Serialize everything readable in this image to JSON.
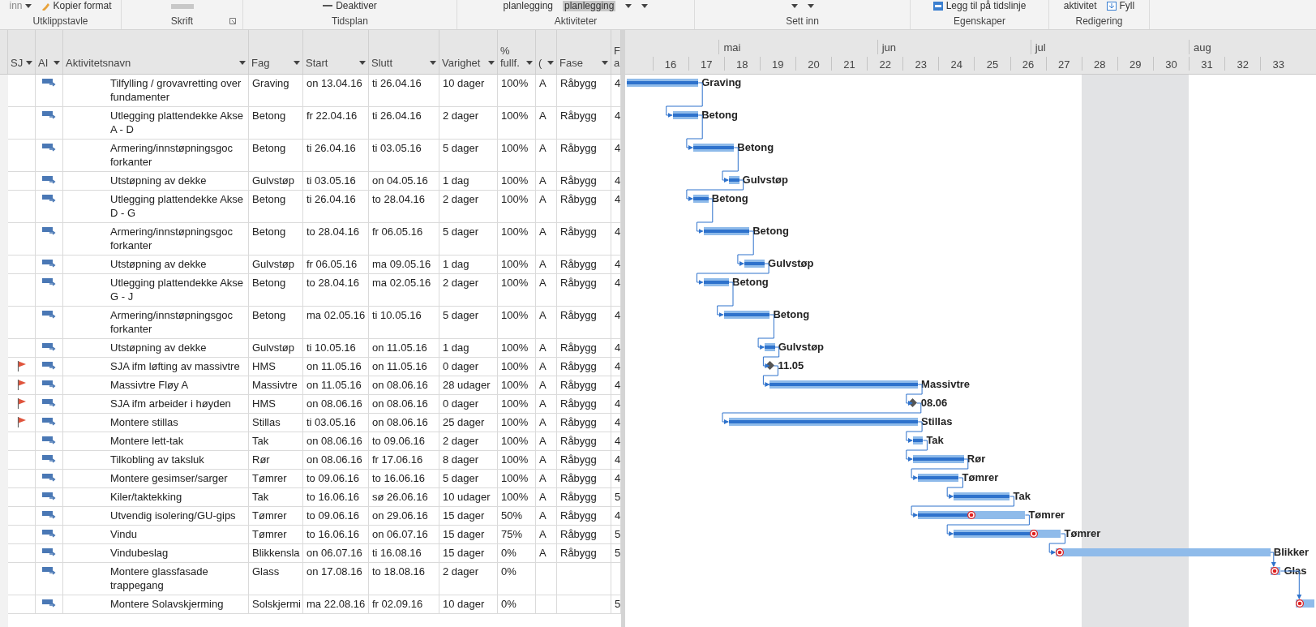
{
  "ribbon": {
    "groups": [
      {
        "label": "Utklippstavle",
        "launcher": false,
        "items": [
          {
            "kind": "menu",
            "text": "inn"
          },
          {
            "kind": "brush",
            "text": "Kopier format"
          }
        ]
      },
      {
        "label": "Skrift",
        "launcher": true,
        "items": [
          {
            "kind": "bar"
          }
        ]
      },
      {
        "label": "Tidsplan",
        "launcher": false,
        "items": [
          {
            "kind": "check",
            "text": "Deaktiver"
          }
        ]
      },
      {
        "label": "Aktiviteter",
        "launcher": false,
        "items": [
          {
            "kind": "plain",
            "text": "planlegging"
          },
          {
            "kind": "highlight",
            "text": "planlegging"
          },
          {
            "kind": "caret"
          },
          {
            "kind": "caret"
          }
        ]
      },
      {
        "label": "Sett inn",
        "launcher": false,
        "items": [
          {
            "kind": "caret"
          },
          {
            "kind": "caret"
          }
        ]
      },
      {
        "label": "Egenskaper",
        "launcher": false,
        "items": [
          {
            "kind": "timeline",
            "text": "Legg til på tidslinje"
          }
        ]
      },
      {
        "label": "Redigering",
        "launcher": false,
        "items": [
          {
            "kind": "plain",
            "text": "aktivitet"
          },
          {
            "kind": "fill",
            "text": "Fyll"
          }
        ]
      }
    ]
  },
  "table": {
    "columns": [
      "SJ",
      "AI",
      "Aktivitetsnavn",
      "Fag",
      "Start",
      "Slutt",
      "Varighet",
      "% fullf.",
      "(",
      "Fase",
      "F a"
    ],
    "rows": [
      {
        "flagged": false,
        "name": "Tilfylling / grovavretting over fundamenter",
        "fag": "Graving",
        "start": "on 13.04.16",
        "slutt": "ti 26.04.16",
        "varighet": "10 dager",
        "fullf": "100%",
        "column_9": "A",
        "fase": "Råbygg",
        "column_11": "4",
        "bar": {
          "kind": "task",
          "label": "Graving",
          "level": 1
        }
      },
      {
        "flagged": false,
        "name": "Utlegging plattendekke Akse A - D",
        "fag": "Betong",
        "start": "fr 22.04.16",
        "slutt": "ti 26.04.16",
        "varighet": "2 dager",
        "fullf": "100%",
        "column_9": "A",
        "fase": "Råbygg",
        "column_11": "4",
        "bar": {
          "kind": "task",
          "label": "Betong",
          "level": 1
        }
      },
      {
        "flagged": false,
        "name": "Armering/innstøpningsgoc forkanter",
        "fag": "Betong",
        "start": "ti 26.04.16",
        "slutt": "ti 03.05.16",
        "varighet": "5 dager",
        "fullf": "100%",
        "column_9": "A",
        "fase": "Råbygg",
        "column_11": "4",
        "bar": {
          "kind": "task",
          "label": "Betong",
          "level": 1
        }
      },
      {
        "flagged": false,
        "name": "Utstøpning av dekke",
        "fag": "Gulvstøp",
        "start": "ti 03.05.16",
        "slutt": "on 04.05.16",
        "varighet": "1 dag",
        "fullf": "100%",
        "column_9": "A",
        "fase": "Råbygg",
        "column_11": "4",
        "bar": {
          "kind": "task",
          "label": "Gulvstøp",
          "level": 1
        }
      },
      {
        "flagged": false,
        "name": "Utlegging plattendekke Akse D - G",
        "fag": "Betong",
        "start": "ti 26.04.16",
        "slutt": "to 28.04.16",
        "varighet": "2 dager",
        "fullf": "100%",
        "column_9": "A",
        "fase": "Råbygg",
        "column_11": "4",
        "bar": {
          "kind": "task",
          "label": "Betong",
          "level": 1
        }
      },
      {
        "flagged": false,
        "name": "Armering/innstøpningsgoc forkanter",
        "fag": "Betong",
        "start": "to 28.04.16",
        "slutt": "fr 06.05.16",
        "varighet": "5 dager",
        "fullf": "100%",
        "column_9": "A",
        "fase": "Råbygg",
        "column_11": "4",
        "bar": {
          "kind": "task",
          "label": "Betong",
          "level": 1
        }
      },
      {
        "flagged": false,
        "name": "Utstøpning av dekke",
        "fag": "Gulvstøp",
        "start": "fr 06.05.16",
        "slutt": "ma 09.05.16",
        "varighet": "1 dag",
        "fullf": "100%",
        "column_9": "A",
        "fase": "Råbygg",
        "column_11": "4",
        "bar": {
          "kind": "task",
          "label": "Gulvstøp",
          "level": 1
        }
      },
      {
        "flagged": false,
        "name": "Utlegging plattendekke Akse G - J",
        "fag": "Betong",
        "start": "to 28.04.16",
        "slutt": "ma 02.05.16",
        "varighet": "2 dager",
        "fullf": "100%",
        "column_9": "A",
        "fase": "Råbygg",
        "column_11": "4",
        "bar": {
          "kind": "task",
          "label": "Betong",
          "level": 1
        }
      },
      {
        "flagged": false,
        "name": "Armering/innstøpningsgoc forkanter",
        "fag": "Betong",
        "start": "ma 02.05.16",
        "slutt": "ti 10.05.16",
        "varighet": "5 dager",
        "fullf": "100%",
        "column_9": "A",
        "fase": "Råbygg",
        "column_11": "4",
        "bar": {
          "kind": "task",
          "label": "Betong",
          "level": 1
        }
      },
      {
        "flagged": false,
        "name": "Utstøpning av dekke",
        "fag": "Gulvstøp",
        "start": "ti 10.05.16",
        "slutt": "on 11.05.16",
        "varighet": "1 dag",
        "fullf": "100%",
        "column_9": "A",
        "fase": "Råbygg",
        "column_11": "4",
        "bar": {
          "kind": "task",
          "label": "Gulvstøp",
          "level": 1
        }
      },
      {
        "flagged": true,
        "name": "SJA ifm løfting av massivtre",
        "fag": "HMS",
        "start": "on 11.05.16",
        "slutt": "on 11.05.16",
        "varighet": "0 dager",
        "fullf": "100%",
        "column_9": "A",
        "fase": "Råbygg",
        "column_11": "4",
        "bar": {
          "kind": "milestone",
          "label": "11.05"
        }
      },
      {
        "flagged": true,
        "name": "Massivtre Fløy A",
        "fag": "Massivtre",
        "start": "on 11.05.16",
        "slutt": "on 08.06.16",
        "varighet": "28 udager",
        "fullf": "100%",
        "column_9": "A",
        "fase": "Råbygg",
        "column_11": "4",
        "bar": {
          "kind": "task",
          "label": "Massivtre",
          "level": 1
        }
      },
      {
        "flagged": true,
        "name": "SJA ifm arbeider i høyden",
        "fag": "HMS",
        "start": "on 08.06.16",
        "slutt": "on 08.06.16",
        "varighet": "0 dager",
        "fullf": "100%",
        "column_9": "A",
        "fase": "Råbygg",
        "column_11": "4",
        "bar": {
          "kind": "milestone",
          "label": "08.06"
        }
      },
      {
        "flagged": true,
        "name": "Montere stillas",
        "fag": "Stillas",
        "start": "ti 03.05.16",
        "slutt": "on 08.06.16",
        "varighet": "25 dager",
        "fullf": "100%",
        "column_9": "A",
        "fase": "Råbygg",
        "column_11": "4",
        "bar": {
          "kind": "task",
          "label": "Stillas",
          "level": 1
        }
      },
      {
        "flagged": false,
        "name": "Montere lett-tak",
        "fag": "Tak",
        "start": "on 08.06.16",
        "slutt": "to 09.06.16",
        "varighet": "2 dager",
        "fullf": "100%",
        "column_9": "A",
        "fase": "Råbygg",
        "column_11": "4",
        "bar": {
          "kind": "task",
          "label": "Tak",
          "level": 1
        }
      },
      {
        "flagged": false,
        "name": "Tilkobling av taksluk",
        "fag": "Rør",
        "start": "on 08.06.16",
        "slutt": "fr 17.06.16",
        "varighet": "8 dager",
        "fullf": "100%",
        "column_9": "A",
        "fase": "Råbygg",
        "column_11": "4",
        "bar": {
          "kind": "task",
          "label": "Rør",
          "level": 1
        }
      },
      {
        "flagged": false,
        "name": "Montere gesimser/sarger",
        "fag": "Tømrer",
        "start": "to 09.06.16",
        "slutt": "to 16.06.16",
        "varighet": "5 dager",
        "fullf": "100%",
        "column_9": "A",
        "fase": "Råbygg",
        "column_11": "4",
        "bar": {
          "kind": "task",
          "label": "Tømrer",
          "level": 1
        }
      },
      {
        "flagged": false,
        "name": "Kiler/taktekking",
        "fag": "Tak",
        "start": "to 16.06.16",
        "slutt": "sø 26.06.16",
        "varighet": "10 udager",
        "fullf": "100%",
        "column_9": "A",
        "fase": "Råbygg",
        "column_11": "5",
        "bar": {
          "kind": "task",
          "label": "Tak",
          "level": 1
        }
      },
      {
        "flagged": false,
        "name": "Utvendig isolering/GU-gips",
        "fag": "Tømrer",
        "start": "to 09.06.16",
        "slutt": "on 29.06.16",
        "varighet": "15 dager",
        "fullf": "50%",
        "column_9": "A",
        "fase": "Råbygg",
        "column_11": "4",
        "bar": {
          "kind": "task",
          "label": "Tømrer",
          "level": 0.5
        }
      },
      {
        "flagged": false,
        "name": "Vindu",
        "fag": "Tømrer",
        "start": "to 16.06.16",
        "slutt": "on 06.07.16",
        "varighet": "15 dager",
        "fullf": "75%",
        "column_9": "A",
        "fase": "Råbygg",
        "column_11": "5",
        "bar": {
          "kind": "task",
          "label": "Tømrer",
          "level": 0.75
        }
      },
      {
        "flagged": false,
        "name": "Vindubeslag",
        "fag": "Blikkensla",
        "start": "on 06.07.16",
        "slutt": "ti 16.08.16",
        "varighet": "15 dager",
        "fullf": "0%",
        "column_9": "A",
        "fase": "Råbygg",
        "column_11": "5",
        "bar": {
          "kind": "task",
          "label": "Blikker",
          "level": 0
        }
      },
      {
        "flagged": false,
        "name": "Montere glassfasade trappegang",
        "fag": "Glass",
        "start": "on 17.08.16",
        "slutt": "to 18.08.16",
        "varighet": "2 dager",
        "fullf": "0%",
        "bar": {
          "kind": "task",
          "label": "Glas",
          "level": 0
        }
      },
      {
        "flagged": false,
        "name": "Montere Solavskjerming",
        "fag": "Solskjermi",
        "start": "ma 22.08.16",
        "slutt": "fr 02.09.16",
        "varighet": "10 dager",
        "fullf": "0%",
        "column_11": "5",
        "bar": {
          "kind": "task",
          "level": 0
        }
      }
    ]
  },
  "timeline": {
    "months": [
      "mai",
      "jun",
      "jul",
      "aug"
    ],
    "weeks": [
      {
        "label": "16",
        "shaded": false
      },
      {
        "label": "17",
        "shaded": false
      },
      {
        "label": "18",
        "shaded": false
      },
      {
        "label": "19",
        "shaded": false
      },
      {
        "label": "20",
        "shaded": false
      },
      {
        "label": "21",
        "shaded": false
      },
      {
        "label": "22",
        "shaded": false
      },
      {
        "label": "23",
        "shaded": false
      },
      {
        "label": "24",
        "shaded": false
      },
      {
        "label": "25",
        "shaded": false
      },
      {
        "label": "26",
        "shaded": false
      },
      {
        "label": "27",
        "shaded": false
      },
      {
        "label": "28",
        "shaded": true
      },
      {
        "label": "29",
        "shaded": true
      },
      {
        "label": "30",
        "shaded": true
      },
      {
        "label": "31",
        "shaded": false
      },
      {
        "label": "32",
        "shaded": false
      },
      {
        "label": "33",
        "shaded": false
      }
    ]
  }
}
